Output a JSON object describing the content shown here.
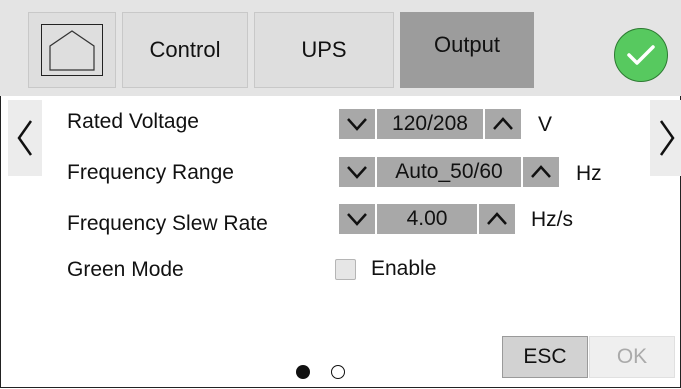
{
  "tabs": {
    "home_icon": "house-icon",
    "control": "Control",
    "ups": "UPS",
    "output": "Output",
    "active": "Output"
  },
  "confirm_icon": "checkmark-icon",
  "settings": {
    "rated_voltage": {
      "label": "Rated Voltage",
      "value": "120/208",
      "unit": "V"
    },
    "frequency_range": {
      "label": "Frequency Range",
      "value": "Auto_50/60",
      "unit": "Hz"
    },
    "frequency_slew_rate": {
      "label": "Frequency Slew Rate",
      "value": "4.00",
      "unit": "Hz/s"
    },
    "green_mode": {
      "label": "Green Mode",
      "checkbox_label": "Enable",
      "checked": false
    }
  },
  "pagination": {
    "current": 1,
    "total": 2
  },
  "buttons": {
    "esc": "ESC",
    "ok": "OK",
    "ok_enabled": false
  },
  "colors": {
    "accent_green": "#57c95f",
    "active_tab": "#9c9c9c",
    "spinner": "#a8a8a8"
  }
}
